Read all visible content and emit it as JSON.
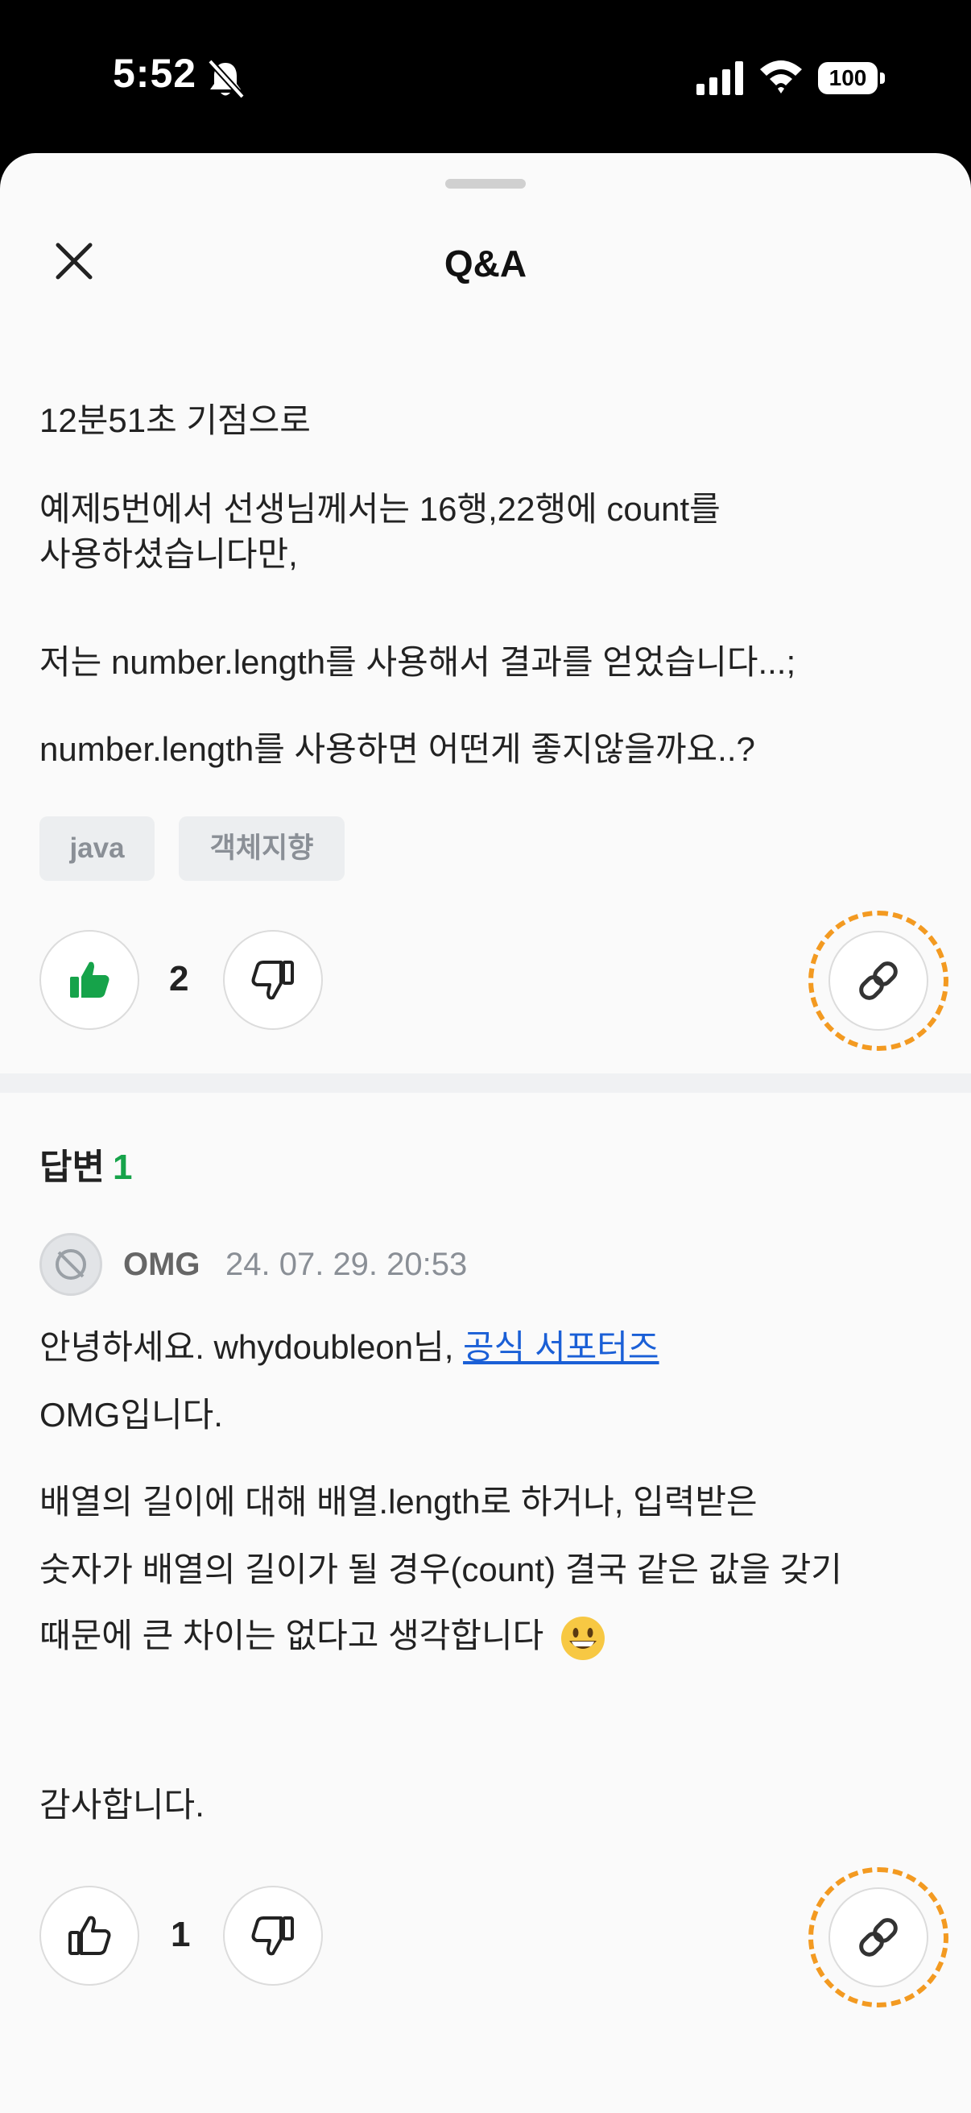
{
  "status_bar": {
    "time": "5:52",
    "battery": "100"
  },
  "sheet": {
    "title": "Q&A"
  },
  "question": {
    "line1": "12분51초 기점으로",
    "line2a": "예제5번에서 선생님께서는 16행,22행에 count를",
    "line2b": "사용하셨습니다만,",
    "line3": "저는 number.length를 사용해서 결과를 얻었습니다...;",
    "line4": "number.length를 사용하면 어떤게 좋지않을까요..?",
    "tags": [
      "java",
      "객체지향"
    ],
    "likes": "2"
  },
  "answers": {
    "label": "답변",
    "count": "1",
    "items": [
      {
        "author": "OMG",
        "date": "24. 07. 29. 20:53",
        "greeting_prefix": "안녕하세요. whydoubleon님, ",
        "greeting_link": "공식 서포터즈",
        "greeting_suffix": "OMG입니다.",
        "body_line1": "배열의 길이에 대해 배열.length로 하거나, 입력받은",
        "body_line2": "숫자가 배열의 길이가 될 경우(count) 결국 같은 값을 갖기",
        "body_line3": "때문에 큰 차이는 없다고 생각합니다",
        "closing": "감사합니다.",
        "likes": "1"
      }
    ]
  },
  "colors": {
    "accent_green": "#16a34a",
    "highlight_orange": "#f39a21",
    "link_blue": "#1a5fd6"
  }
}
